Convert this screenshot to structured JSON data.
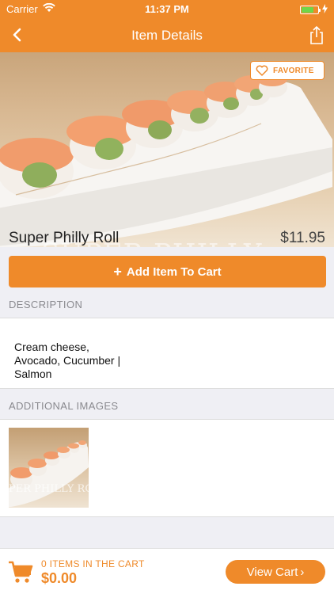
{
  "status_bar": {
    "carrier": "Carrier",
    "time": "11:37 PM",
    "battery_level": 0.75,
    "battery_color": "#6fd64a"
  },
  "nav": {
    "title": "Item Details",
    "back_icon": "chevron-left-icon",
    "share_icon": "share-icon"
  },
  "hero": {
    "favorite_label": "FAVORITE",
    "watermark": "SUPER PHILLY ROLL"
  },
  "item": {
    "name": "Super Philly Roll",
    "price": "$11.95",
    "add_button_icon": "+",
    "add_button_label": "Add Item To Cart"
  },
  "sections": {
    "description_header": "DESCRIPTION",
    "description_lines": [
      "Cream cheese,",
      "Avocado, Cucumber |",
      "Salmon"
    ],
    "images_header": "ADDITIONAL IMAGES",
    "thumbnail_watermark": "PER PHILLY ROLL"
  },
  "cart": {
    "count_label": "0 ITEMS IN THE CART",
    "total": "$0.00",
    "view_label": "View Cart",
    "view_chevron": "›"
  },
  "colors": {
    "accent": "#ef8a2a",
    "background": "#efeff4"
  }
}
